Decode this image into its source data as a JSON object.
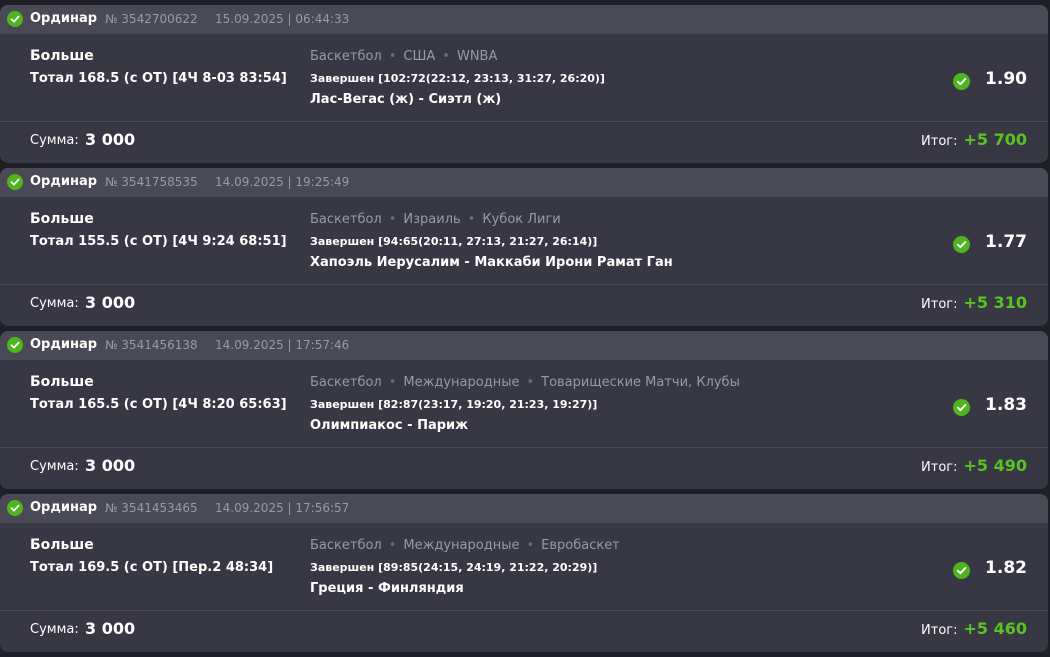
{
  "colors": {
    "page_bg": "#1f1f27",
    "card_bg": "#383844",
    "header_bg": "#4a4a56",
    "win_green": "#4fb51c",
    "muted_text": "#9a9aa6",
    "profit_green": "#58c321"
  },
  "icons": {
    "status": "check-circle-icon"
  },
  "bets": [
    {
      "type": "Ординар",
      "id": "№ 3542700622",
      "date": "15.09.2025 | 06:44:33",
      "pick": "Больше",
      "market": "Тотал 168.5 (с ОТ) [4Ч 8-03 83:54]",
      "breadcrumb": [
        "Баскетбол",
        "США",
        "WNBA"
      ],
      "status": "Завершен [102:72(22:12, 23:13, 31:27, 26:20)]",
      "teams": "Лас-Вегас (ж) - Сиэтл (ж)",
      "odds": "1.90",
      "sum_label": "Сумма:",
      "sum": "3 000",
      "result_label": "Итог:",
      "result": "+5 700"
    },
    {
      "type": "Ординар",
      "id": "№ 3541758535",
      "date": "14.09.2025 | 19:25:49",
      "pick": "Больше",
      "market": "Тотал 155.5 (с ОТ) [4Ч 9:24 68:51]",
      "breadcrumb": [
        "Баскетбол",
        "Израиль",
        "Кубок Лиги"
      ],
      "status": "Завершен [94:65(20:11, 27:13, 21:27, 26:14)]",
      "teams": "Хапоэль Иерусалим - Маккаби Ирони Рамат Ган",
      "odds": "1.77",
      "sum_label": "Сумма:",
      "sum": "3 000",
      "result_label": "Итог:",
      "result": "+5 310"
    },
    {
      "type": "Ординар",
      "id": "№ 3541456138",
      "date": "14.09.2025 | 17:57:46",
      "pick": "Больше",
      "market": "Тотал 165.5 (с ОТ) [4Ч 8:20 65:63]",
      "breadcrumb": [
        "Баскетбол",
        "Международные",
        "Товарищеские Матчи, Клубы"
      ],
      "status": "Завершен [82:87(23:17, 19:20, 21:23, 19:27)]",
      "teams": "Олимпиакос - Париж",
      "odds": "1.83",
      "sum_label": "Сумма:",
      "sum": "3 000",
      "result_label": "Итог:",
      "result": "+5 490"
    },
    {
      "type": "Ординар",
      "id": "№ 3541453465",
      "date": "14.09.2025 | 17:56:57",
      "pick": "Больше",
      "market": "Тотал 169.5 (с ОТ) [Пер.2 48:34]",
      "breadcrumb": [
        "Баскетбол",
        "Международные",
        "Евробаскет"
      ],
      "status": "Завершен [89:85(24:15, 24:19, 21:22, 20:29)]",
      "teams": "Греция - Финляндия",
      "odds": "1.82",
      "sum_label": "Сумма:",
      "sum": "3 000",
      "result_label": "Итог:",
      "result": "+5 460"
    }
  ]
}
